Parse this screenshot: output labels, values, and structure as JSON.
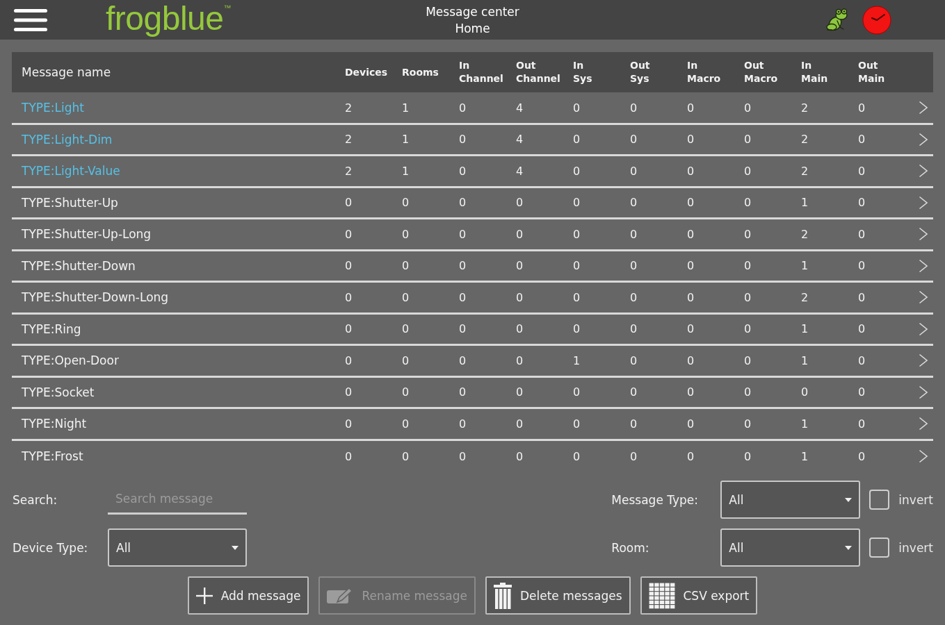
{
  "header": {
    "logo": "frogblue$^{™}$",
    "title": "Message center",
    "subtitle": "Home"
  },
  "table": {
    "columns": [
      "Message name",
      "Devices",
      "Rooms",
      "In Channel",
      "Out Channel",
      "In Sys",
      "Out Sys",
      "In Macro",
      "Out Macro",
      "In Main",
      "Out Main"
    ],
    "rows": [
      {
        "name": "TYPE:Light",
        "highlighted": true,
        "values": [
          "2",
          "1",
          "0",
          "4",
          "0",
          "0",
          "0",
          "0",
          "2",
          "0"
        ]
      },
      {
        "name": "TYPE:Light-Dim",
        "highlighted": true,
        "values": [
          "2",
          "1",
          "0",
          "4",
          "0",
          "0",
          "0",
          "0",
          "2",
          "0"
        ]
      },
      {
        "name": "TYPE:Light-Value",
        "highlighted": true,
        "values": [
          "2",
          "1",
          "0",
          "4",
          "0",
          "0",
          "0",
          "0",
          "2",
          "0"
        ]
      },
      {
        "name": "TYPE:Shutter-Up",
        "highlighted": false,
        "values": [
          "0",
          "0",
          "0",
          "0",
          "0",
          "0",
          "0",
          "0",
          "1",
          "0"
        ]
      },
      {
        "name": "TYPE:Shutter-Up-Long",
        "highlighted": false,
        "values": [
          "0",
          "0",
          "0",
          "0",
          "0",
          "0",
          "0",
          "0",
          "2",
          "0"
        ]
      },
      {
        "name": "TYPE:Shutter-Down",
        "highlighted": false,
        "values": [
          "0",
          "0",
          "0",
          "0",
          "0",
          "0",
          "0",
          "0",
          "1",
          "0"
        ]
      },
      {
        "name": "TYPE:Shutter-Down-Long",
        "highlighted": false,
        "values": [
          "0",
          "0",
          "0",
          "0",
          "0",
          "0",
          "0",
          "0",
          "2",
          "0"
        ]
      },
      {
        "name": "TYPE:Ring",
        "highlighted": false,
        "values": [
          "0",
          "0",
          "0",
          "0",
          "0",
          "0",
          "0",
          "0",
          "1",
          "0"
        ]
      },
      {
        "name": "TYPE:Open-Door",
        "highlighted": false,
        "values": [
          "0",
          "0",
          "0",
          "0",
          "1",
          "0",
          "0",
          "0",
          "1",
          "0"
        ]
      },
      {
        "name": "TYPE:Socket",
        "highlighted": false,
        "values": [
          "0",
          "0",
          "0",
          "0",
          "0",
          "0",
          "0",
          "0",
          "0",
          "0"
        ]
      },
      {
        "name": "TYPE:Night",
        "highlighted": false,
        "values": [
          "0",
          "0",
          "0",
          "0",
          "0",
          "0",
          "0",
          "0",
          "1",
          "0"
        ]
      },
      {
        "name": "TYPE:Frost",
        "highlighted": false,
        "values": [
          "0",
          "0",
          "0",
          "0",
          "0",
          "0",
          "0",
          "0",
          "1",
          "0"
        ]
      }
    ]
  },
  "filters": {
    "search": {
      "label": "Search:",
      "placeholder": "Search message"
    },
    "device_type": {
      "label": "Device Type:",
      "value": "All"
    },
    "message_type": {
      "label": "Message Type:",
      "value": "All",
      "invert": {
        "label": "invert",
        "checked": false
      }
    },
    "room": {
      "label": "Room:",
      "value": "All",
      "invert": {
        "label": "invert",
        "checked": false
      }
    }
  },
  "buttons": [
    {
      "kind": "add",
      "label": "Add message",
      "disabled": false
    },
    {
      "kind": "rename",
      "label": "Rename message",
      "disabled": true
    },
    {
      "kind": "delete",
      "label": "Delete messages",
      "disabled": false
    },
    {
      "kind": "export",
      "label": "CSV export",
      "disabled": false
    }
  ]
}
